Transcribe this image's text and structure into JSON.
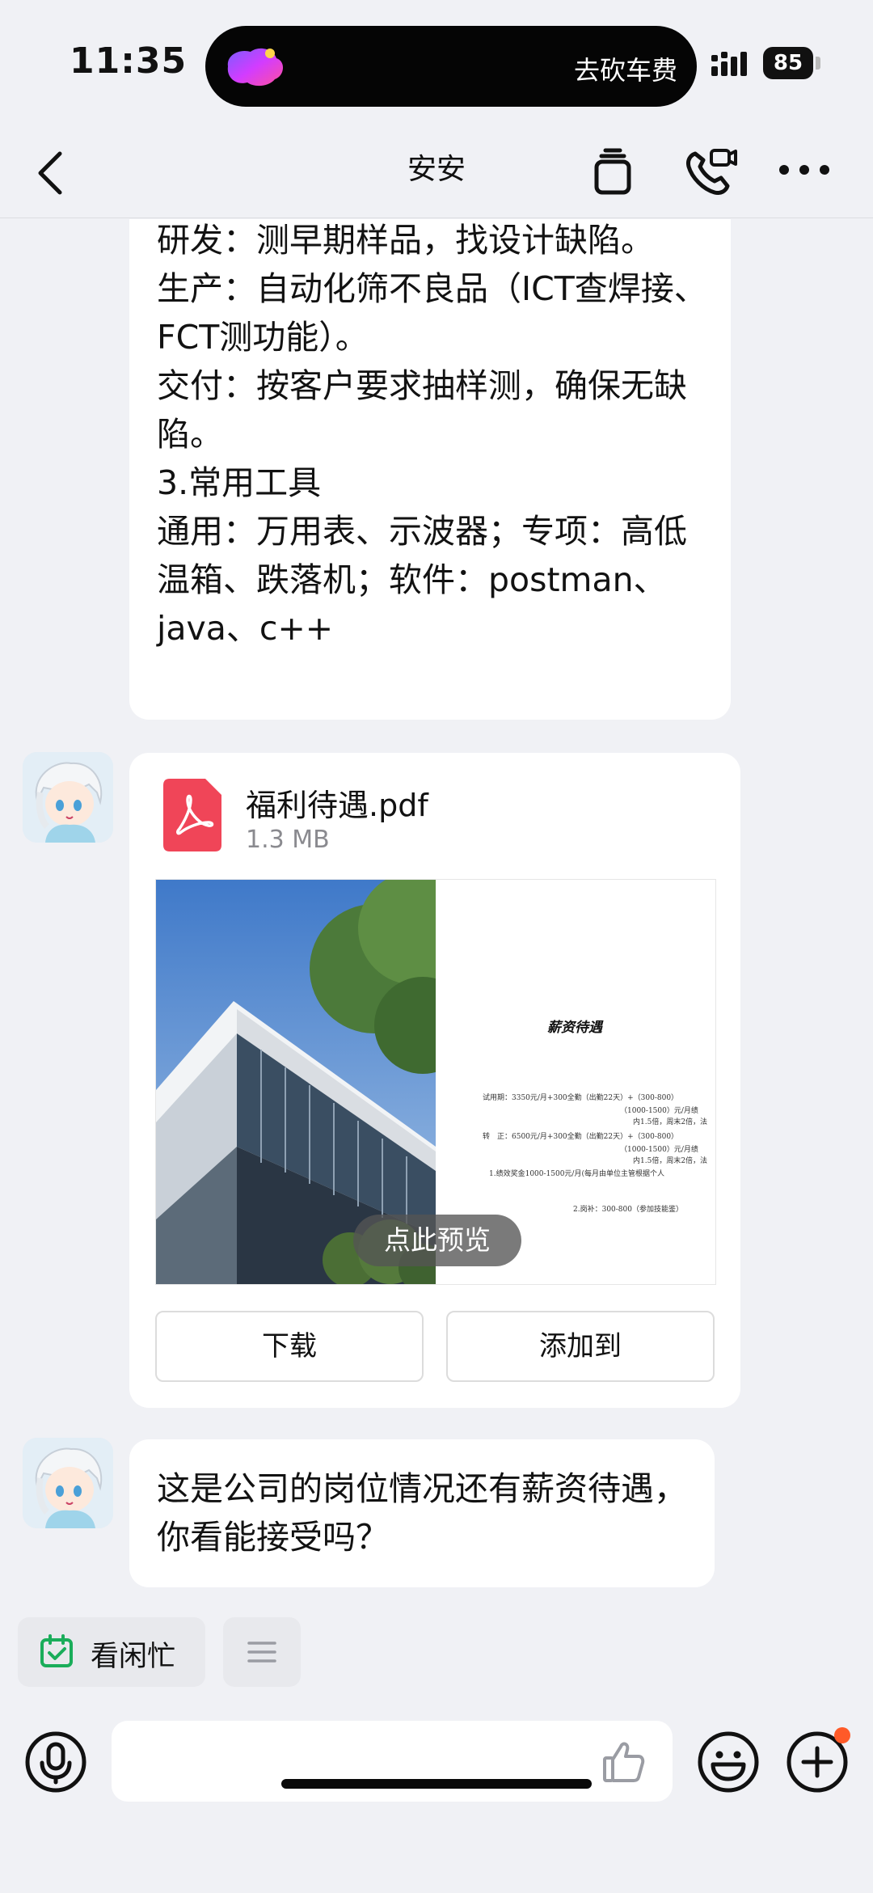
{
  "status_bar": {
    "time": "11:35",
    "island_text": "去砍车费",
    "battery": "85"
  },
  "nav": {
    "title": "安安"
  },
  "messages": {
    "first_text": "研发：测早期样品，找设计缺陷。\n生产：自动化筛不良品（ICT查焊接、FCT测功能）。\n交付：按客户要求抽样测，确保无缺陷。\n3.常用工具\n通用：万用表、示波器；专项：高低温箱、跌落机；软件：postman、java、c++",
    "file": {
      "name": "福利待遇.pdf",
      "size": "1.3 MB",
      "preview_label": "点此预览",
      "doc_title": "薪资待遇",
      "doc_lines": [
        "试用期：3350元/月+300全勤（出勤22天）+（300-800）",
        "（1000-1500）元/月绩",
        "内1.5倍，周末2倍，法",
        "转　正：6500元/月+300全勤（出勤22天）+（300-800）",
        "（1000-1500）元/月绩",
        "内1.5倍，周末2倍，法",
        "1.绩效奖金1000-1500元/月(每月由单位主管根据个人",
        "2.岗补：300-800（参加技能鉴）"
      ],
      "download_label": "下载",
      "add_to_label": "添加到"
    },
    "last_text": "这是公司的岗位情况还有薪资待遇，你看能接受吗？"
  },
  "quick_actions": {
    "busy_label": "看闲忙"
  },
  "colors": {
    "background": "#f0f1f5",
    "bubble": "#ffffff",
    "pdf_red": "#f04558",
    "busy_green": "#1aad5a",
    "badge_orange": "#ff5a28"
  },
  "icons": [
    "back-icon",
    "copy-icon",
    "video-call-icon",
    "more-icon",
    "pdf-icon",
    "calendar-check-icon",
    "menu-lines-icon",
    "voice-icon",
    "thumb-up-icon",
    "emoji-icon",
    "plus-icon"
  ]
}
